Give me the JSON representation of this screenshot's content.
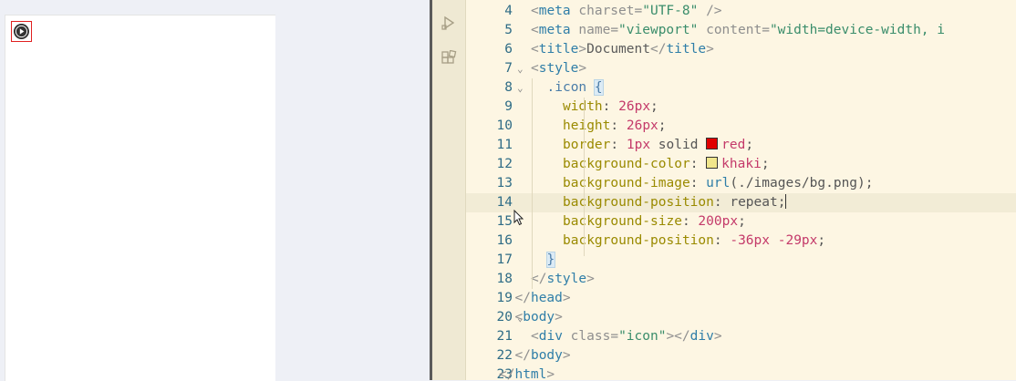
{
  "editor": {
    "lines": [
      {
        "num": "4",
        "parts": [
          [
            "br",
            "<"
          ],
          [
            "tag",
            "meta"
          ],
          [
            "text",
            " "
          ],
          [
            "attr",
            "charset"
          ],
          [
            "br",
            "="
          ],
          [
            "str",
            "\"UTF-8\""
          ],
          [
            "text",
            " "
          ],
          [
            "br",
            "/>"
          ]
        ]
      },
      {
        "num": "5",
        "parts": [
          [
            "br",
            "<"
          ],
          [
            "tag",
            "meta"
          ],
          [
            "text",
            " "
          ],
          [
            "attr",
            "name"
          ],
          [
            "br",
            "="
          ],
          [
            "str",
            "\"viewport\""
          ],
          [
            "text",
            " "
          ],
          [
            "attr",
            "content"
          ],
          [
            "br",
            "="
          ],
          [
            "str",
            "\"width=device-width, i"
          ]
        ]
      },
      {
        "num": "6",
        "parts": [
          [
            "br",
            "<"
          ],
          [
            "tag",
            "title"
          ],
          [
            "br",
            ">"
          ],
          [
            "text",
            "Document"
          ],
          [
            "br",
            "</"
          ],
          [
            "tag",
            "title"
          ],
          [
            "br",
            ">"
          ]
        ]
      },
      {
        "num": "7",
        "parts": [
          [
            "br",
            "<"
          ],
          [
            "tag",
            "style"
          ],
          [
            "br",
            ">"
          ]
        ]
      },
      {
        "num": "8",
        "parts": [
          [
            "sel",
            ".icon "
          ],
          [
            "bracehl",
            "{"
          ]
        ]
      },
      {
        "num": "9",
        "parts": [
          [
            "prop",
            "width"
          ],
          [
            "val",
            ": "
          ],
          [
            "num",
            "26px"
          ],
          [
            "val",
            ";"
          ]
        ]
      },
      {
        "num": "10",
        "parts": [
          [
            "prop",
            "height"
          ],
          [
            "val",
            ": "
          ],
          [
            "num",
            "26px"
          ],
          [
            "val",
            ";"
          ]
        ]
      },
      {
        "num": "11",
        "parts": [
          [
            "prop",
            "border"
          ],
          [
            "val",
            ": "
          ],
          [
            "num",
            "1px"
          ],
          [
            "val",
            " solid "
          ],
          [
            "swatch-red",
            ""
          ],
          [
            "num",
            "red"
          ],
          [
            "val",
            ";"
          ]
        ]
      },
      {
        "num": "12",
        "parts": [
          [
            "prop",
            "background-color"
          ],
          [
            "val",
            ": "
          ],
          [
            "swatch-khaki",
            ""
          ],
          [
            "num",
            "khaki"
          ],
          [
            "val",
            ";"
          ]
        ]
      },
      {
        "num": "13",
        "parts": [
          [
            "prop",
            "background-image"
          ],
          [
            "val",
            ": "
          ],
          [
            "fn",
            "url"
          ],
          [
            "val",
            "(./images/bg.png);"
          ]
        ]
      },
      {
        "num": "14",
        "parts": [
          [
            "prop",
            "background-position"
          ],
          [
            "val",
            ": repeat;"
          ],
          [
            "caret",
            ""
          ]
        ]
      },
      {
        "num": "15",
        "parts": [
          [
            "prop",
            "background-size"
          ],
          [
            "val",
            ": "
          ],
          [
            "num",
            "200px"
          ],
          [
            "val",
            ";"
          ]
        ]
      },
      {
        "num": "16",
        "parts": [
          [
            "prop",
            "background-position"
          ],
          [
            "val",
            ": "
          ],
          [
            "num",
            "-36px"
          ],
          [
            "val",
            " "
          ],
          [
            "num",
            "-29px"
          ],
          [
            "val",
            ";"
          ]
        ]
      },
      {
        "num": "17",
        "parts": [
          [
            "bracehl",
            "}"
          ]
        ]
      },
      {
        "num": "18",
        "parts": [
          [
            "br",
            "</"
          ],
          [
            "tag",
            "style"
          ],
          [
            "br",
            ">"
          ]
        ]
      },
      {
        "num": "19",
        "parts": [
          [
            "br",
            "</"
          ],
          [
            "tag",
            "head"
          ],
          [
            "br",
            ">"
          ]
        ]
      },
      {
        "num": "20",
        "parts": [
          [
            "br",
            "<"
          ],
          [
            "tag",
            "body"
          ],
          [
            "br",
            ">"
          ]
        ]
      },
      {
        "num": "21",
        "parts": [
          [
            "br",
            "<"
          ],
          [
            "tag",
            "div"
          ],
          [
            "text",
            " "
          ],
          [
            "attr",
            "class"
          ],
          [
            "br",
            "="
          ],
          [
            "str",
            "\"icon\""
          ],
          [
            "br",
            "></"
          ],
          [
            "tag",
            "div"
          ],
          [
            "br",
            ">"
          ]
        ]
      },
      {
        "num": "22",
        "parts": [
          [
            "br",
            "</"
          ],
          [
            "tag",
            "body"
          ],
          [
            "br",
            ">"
          ]
        ]
      },
      {
        "num": "23",
        "parts": [
          [
            "br",
            "</"
          ],
          [
            "tag",
            "html"
          ],
          [
            "br",
            ">"
          ]
        ]
      }
    ],
    "indents": [
      4,
      4,
      4,
      4,
      5,
      6,
      6,
      6,
      6,
      6,
      6,
      6,
      6,
      5,
      4,
      3,
      3,
      4,
      3,
      2
    ],
    "folds": {
      "7": "⌄",
      "8": "⌄",
      "20": "⌄"
    },
    "current_line": "14"
  },
  "colors": {
    "swatch_red": "#e00000",
    "swatch_khaki": "#f0e68c"
  },
  "icons": {
    "preview": "play-circle-icon",
    "run": "run-icon",
    "extensions": "extensions-icon",
    "cursor": "mouse-cursor-icon"
  }
}
